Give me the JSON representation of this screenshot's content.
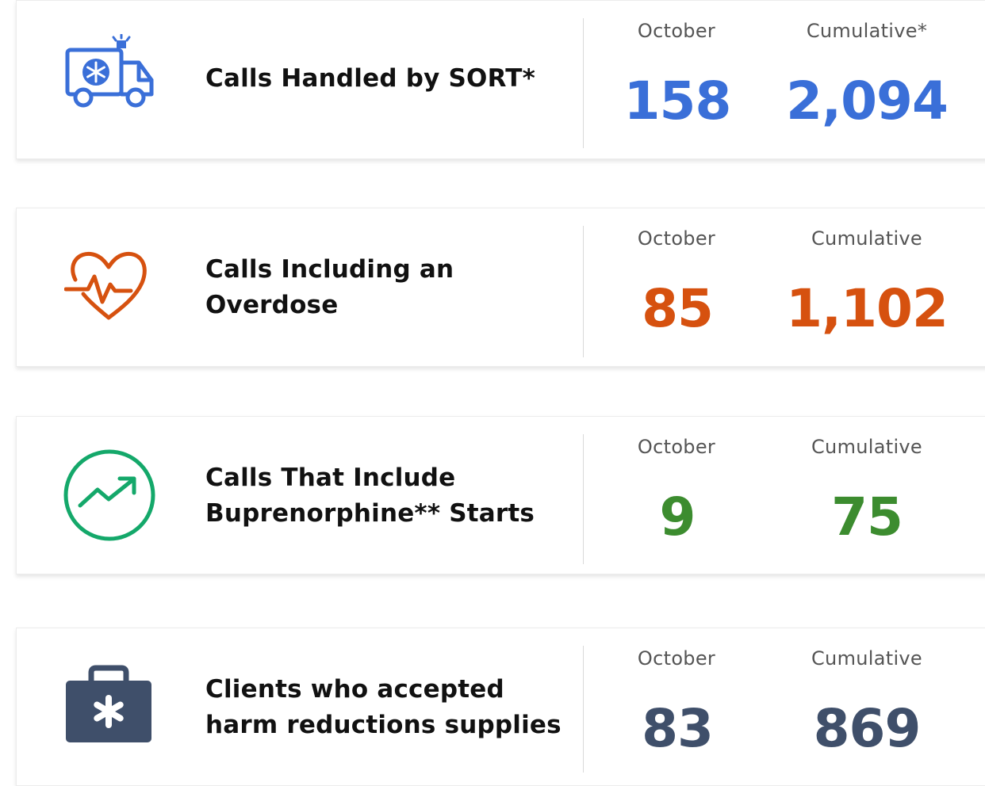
{
  "colors": {
    "blue": "#3a6fd8",
    "orange": "#d6510f",
    "green": "#3c8c2f",
    "slate": "#3f4f6a",
    "green_icon": "#14a86a"
  },
  "cards": [
    {
      "icon": "ambulance-icon",
      "title_line1": "Calls Handled by SORT*",
      "title_line2": "",
      "label_month": "October",
      "label_cumulative": "Cumulative*",
      "value_month": "158",
      "value_cumulative": "2,094"
    },
    {
      "icon": "heart-pulse-icon",
      "title_line1": "Calls Including an",
      "title_line2": "Overdose",
      "label_month": "October",
      "label_cumulative": "Cumulative",
      "value_month": "85",
      "value_cumulative": "1,102"
    },
    {
      "icon": "trending-up-icon",
      "title_line1": "Calls That Include",
      "title_line2": "Buprenorphine** Starts",
      "label_month": "October",
      "label_cumulative": "Cumulative",
      "value_month": "9",
      "value_cumulative": "75"
    },
    {
      "icon": "medical-kit-icon",
      "title_line1": "Clients who accepted",
      "title_line2": "harm reductions supplies",
      "label_month": "October",
      "label_cumulative": "Cumulative",
      "value_month": "83",
      "value_cumulative": "869"
    }
  ]
}
